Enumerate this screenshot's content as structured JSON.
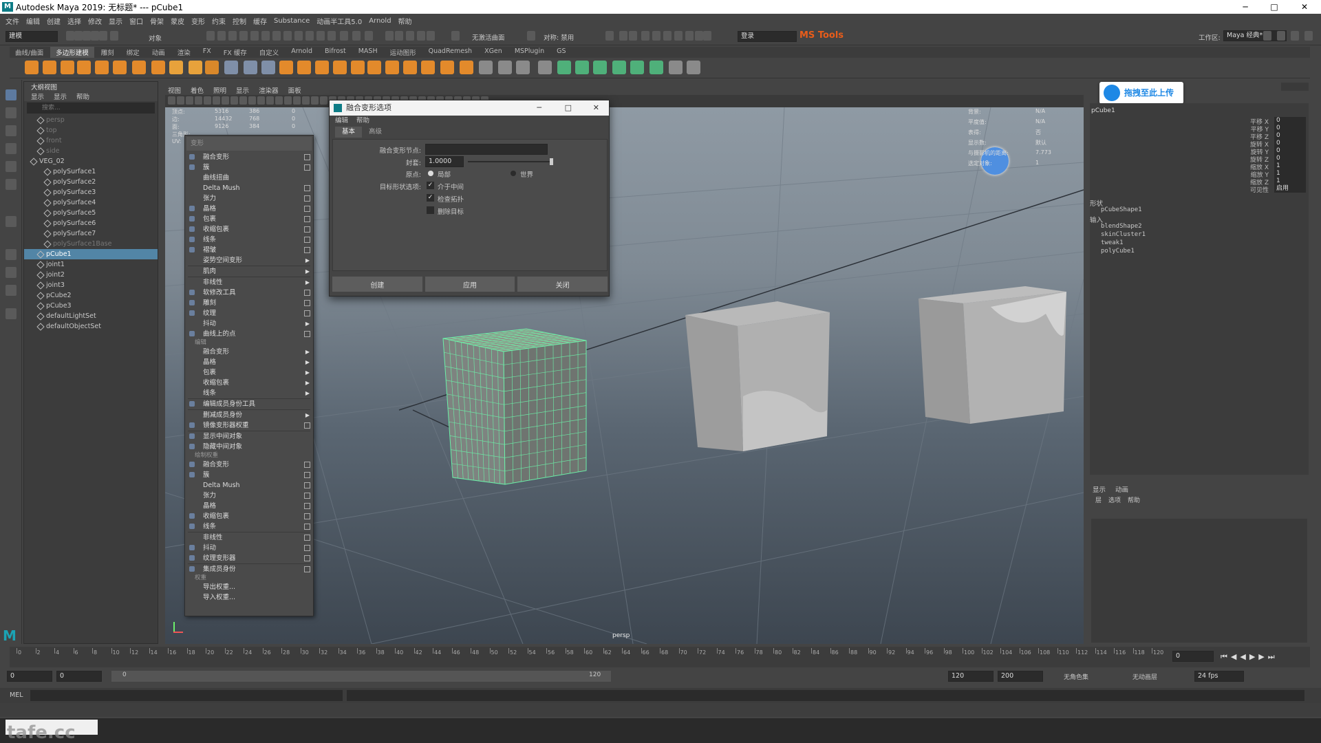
{
  "window": {
    "title": "Autodesk Maya 2019: 无标题*   ---   pCube1",
    "min": "─",
    "max": "□",
    "close": "✕"
  },
  "menubar": [
    "文件",
    "编辑",
    "创建",
    "选择",
    "修改",
    "显示",
    "窗口",
    "骨架",
    "蒙皮",
    "变形",
    "约束",
    "控制",
    "缓存",
    "Substance",
    "动画半工具5.0",
    "Arnold",
    "帮助"
  ],
  "statusline": {
    "menuset": "建模",
    "objects_label": "对象",
    "live_label": "无激活曲面",
    "symmetry_label": "对称: 禁用",
    "login": "登录",
    "mstools": "MS Tools",
    "workspace_label": "工作区:",
    "workspace": "Maya 经典*"
  },
  "shelf_tabs": [
    "曲线/曲面",
    "多边形建模",
    "雕刻",
    "绑定",
    "动画",
    "渲染",
    "FX",
    "FX 缓存",
    "自定义",
    "Arnold",
    "Bifrost",
    "MASH",
    "运动图形",
    "QuadRemesh",
    "XGen",
    "MSPlugin",
    "GS"
  ],
  "shelf_active": 1,
  "outliner": {
    "tab": "大纲视图",
    "menu": [
      "显示",
      "显示",
      "帮助"
    ],
    "search": "搜索...",
    "items": [
      {
        "label": "persp",
        "dim": true,
        "indent": 1
      },
      {
        "label": "top",
        "dim": true,
        "indent": 1
      },
      {
        "label": "front",
        "dim": true,
        "indent": 1
      },
      {
        "label": "side",
        "dim": true,
        "indent": 1
      },
      {
        "label": "VEG_02",
        "indent": 0
      },
      {
        "label": "polySurface1",
        "indent": 2
      },
      {
        "label": "polySurface2",
        "indent": 2
      },
      {
        "label": "polySurface3",
        "indent": 2
      },
      {
        "label": "polySurface4",
        "indent": 2
      },
      {
        "label": "polySurface5",
        "indent": 2
      },
      {
        "label": "polySurface6",
        "indent": 2
      },
      {
        "label": "polySurface7",
        "indent": 2
      },
      {
        "label": "polySurface1Base",
        "dim": true,
        "indent": 2
      },
      {
        "label": "pCube1",
        "sel": true,
        "indent": 1
      },
      {
        "label": "joint1",
        "indent": 1
      },
      {
        "label": "joint2",
        "indent": 1
      },
      {
        "label": "joint3",
        "indent": 1
      },
      {
        "label": "pCube2",
        "indent": 1
      },
      {
        "label": "pCube3",
        "indent": 1
      },
      {
        "label": "defaultLightSet",
        "indent": 1
      },
      {
        "label": "defaultObjectSet",
        "indent": 1
      }
    ]
  },
  "viewport": {
    "menu": [
      "视图",
      "着色",
      "照明",
      "显示",
      "渲染器",
      "面板"
    ],
    "camera": "persp",
    "hud_left": [
      [
        "顶点:",
        "5316",
        "386",
        "0"
      ],
      [
        "边:",
        "14432",
        "768",
        "0"
      ],
      [
        "面:",
        "9126",
        "384",
        "0"
      ],
      [
        "三角形:",
        "",
        "",
        ""
      ],
      [
        "UV:",
        "",
        "",
        ""
      ]
    ],
    "hud_right": [
      [
        "背景:",
        "N/A"
      ],
      [
        "平度值:",
        "N/A"
      ],
      [
        "表得:",
        "否"
      ],
      [
        "显示数:",
        "默认"
      ],
      [
        "与摄影机的距离:",
        "7.773"
      ],
      [
        "选定对象:",
        "1"
      ]
    ]
  },
  "deform_menu": {
    "title": "变形",
    "items": [
      {
        "t": "item",
        "label": "融合变形",
        "opt": true,
        "ic": true
      },
      {
        "t": "item",
        "label": "簇",
        "opt": true,
        "ic": true
      },
      {
        "t": "item",
        "label": "曲线扭曲"
      },
      {
        "t": "item",
        "label": "Delta Mush",
        "opt": true
      },
      {
        "t": "item",
        "label": "张力",
        "opt": true
      },
      {
        "t": "item",
        "label": "晶格",
        "opt": true,
        "ic": true
      },
      {
        "t": "item",
        "label": "包裹",
        "opt": true,
        "ic": true
      },
      {
        "t": "item",
        "label": "收缩包裹",
        "opt": true,
        "ic": true
      },
      {
        "t": "item",
        "label": "线条",
        "opt": true,
        "ic": true
      },
      {
        "t": "item",
        "label": "褶皱",
        "opt": true,
        "ic": true
      },
      {
        "t": "item",
        "label": "姿势空间变形",
        "arr": true
      },
      {
        "t": "sep"
      },
      {
        "t": "item",
        "label": "肌肉",
        "arr": true
      },
      {
        "t": "sep"
      },
      {
        "t": "item",
        "label": "非线性",
        "arr": true
      },
      {
        "t": "item",
        "label": "软修改工具",
        "opt": true,
        "ic": true
      },
      {
        "t": "item",
        "label": "雕刻",
        "opt": true,
        "ic": true
      },
      {
        "t": "item",
        "label": "纹理",
        "opt": true,
        "ic": true
      },
      {
        "t": "item",
        "label": "抖动",
        "arr": true
      },
      {
        "t": "item",
        "label": "曲线上的点",
        "opt": true,
        "ic": true
      },
      {
        "t": "sec",
        "label": "编辑"
      },
      {
        "t": "item",
        "label": "融合变形",
        "arr": true
      },
      {
        "t": "item",
        "label": "晶格",
        "arr": true
      },
      {
        "t": "item",
        "label": "包裹",
        "arr": true
      },
      {
        "t": "item",
        "label": "收缩包裹",
        "arr": true
      },
      {
        "t": "item",
        "label": "线条",
        "arr": true
      },
      {
        "t": "sep"
      },
      {
        "t": "item",
        "label": "编辑成员身份工具",
        "ic": true
      },
      {
        "t": "sep"
      },
      {
        "t": "item",
        "label": "删减成员身份",
        "arr": true
      },
      {
        "t": "item",
        "label": "镜像变形器权重",
        "opt": true,
        "ic": true
      },
      {
        "t": "sep"
      },
      {
        "t": "item",
        "label": "显示中间对象",
        "ic": true
      },
      {
        "t": "item",
        "label": "隐藏中间对象",
        "ic": true
      },
      {
        "t": "sec",
        "label": "绘制权重"
      },
      {
        "t": "item",
        "label": "融合变形",
        "opt": true,
        "ic": true
      },
      {
        "t": "item",
        "label": "簇",
        "opt": true,
        "ic": true
      },
      {
        "t": "item",
        "label": "Delta Mush",
        "opt": true
      },
      {
        "t": "item",
        "label": "张力",
        "opt": true
      },
      {
        "t": "item",
        "label": "晶格",
        "opt": true
      },
      {
        "t": "item",
        "label": "收缩包裹",
        "opt": true,
        "ic": true
      },
      {
        "t": "item",
        "label": "线条",
        "opt": true,
        "ic": true
      },
      {
        "t": "sep"
      },
      {
        "t": "item",
        "label": "非线性",
        "opt": true
      },
      {
        "t": "item",
        "label": "抖动",
        "opt": true,
        "ic": true
      },
      {
        "t": "item",
        "label": "纹理变形器",
        "opt": true,
        "ic": true
      },
      {
        "t": "sep"
      },
      {
        "t": "item",
        "label": "集成员身份",
        "opt": true,
        "ic": true
      },
      {
        "t": "sec",
        "label": "权重"
      },
      {
        "t": "item",
        "label": "导出权重..."
      },
      {
        "t": "item",
        "label": "导入权重..."
      }
    ]
  },
  "blend_dialog": {
    "title": "融合变形选项",
    "menu": [
      "编辑",
      "帮助"
    ],
    "tabs": [
      "基本",
      "高级"
    ],
    "node_label": "融合变形节点:",
    "node_value": "",
    "envelope_label": "封套:",
    "envelope_value": "1.0000",
    "envelope_fraction": 1.0,
    "origin_label": "原点:",
    "origin_local": "局部",
    "origin_world": "世界",
    "target_label": "目标形状选项:",
    "opt1": "介于中间",
    "opt2": "检查拓扑",
    "opt3": "删除目标",
    "buttons": [
      "创建",
      "应用",
      "关闭"
    ]
  },
  "upload_badge": "拖拽至此上传",
  "channel_box": {
    "object": "pCube1",
    "channels": [
      [
        "平移 X",
        "0"
      ],
      [
        "平移 Y",
        "0"
      ],
      [
        "平移 Z",
        "0"
      ],
      [
        "旋转 X",
        "0"
      ],
      [
        "旋转 Y",
        "0"
      ],
      [
        "旋转 Z",
        "0"
      ],
      [
        "缩放 X",
        "1"
      ],
      [
        "缩放 Y",
        "1"
      ],
      [
        "缩放 Z",
        "1"
      ],
      [
        "可见性",
        "启用"
      ]
    ],
    "shapes_label": "形状",
    "shape": "pCubeShape1",
    "inputs_label": "输入",
    "inputs": [
      "blendShape2",
      "skinCluster1",
      "tweak1",
      "polyCube1"
    ]
  },
  "layer_editor": {
    "tabs": [
      "显示",
      "动画"
    ],
    "menu": [
      "层",
      "选项",
      "帮助"
    ]
  },
  "timeline": {
    "ticks": [
      "0",
      "2",
      "4",
      "6",
      "8",
      "10",
      "12",
      "14",
      "16",
      "18",
      "20",
      "22",
      "24",
      "26",
      "28",
      "30",
      "32",
      "34",
      "36",
      "38",
      "40",
      "42",
      "44",
      "46",
      "48",
      "50",
      "52",
      "54",
      "56",
      "58",
      "60",
      "62",
      "64",
      "66",
      "68",
      "70",
      "72",
      "74",
      "76",
      "78",
      "80",
      "82",
      "84",
      "86",
      "88",
      "90",
      "92",
      "94",
      "96",
      "98",
      "100",
      "102",
      "104",
      "106",
      "108",
      "110",
      "112",
      "114",
      "116",
      "118",
      "120"
    ],
    "current": "0"
  },
  "range": {
    "start": "0",
    "start2": "0",
    "slider_start": "0",
    "slider_end": "120",
    "end": "120",
    "end2": "200",
    "char_set": "无角色集",
    "anim_layer": "无动画层",
    "fps": "24 fps"
  },
  "cmdline": {
    "label": "MEL"
  },
  "watermark": "tafe.cc"
}
